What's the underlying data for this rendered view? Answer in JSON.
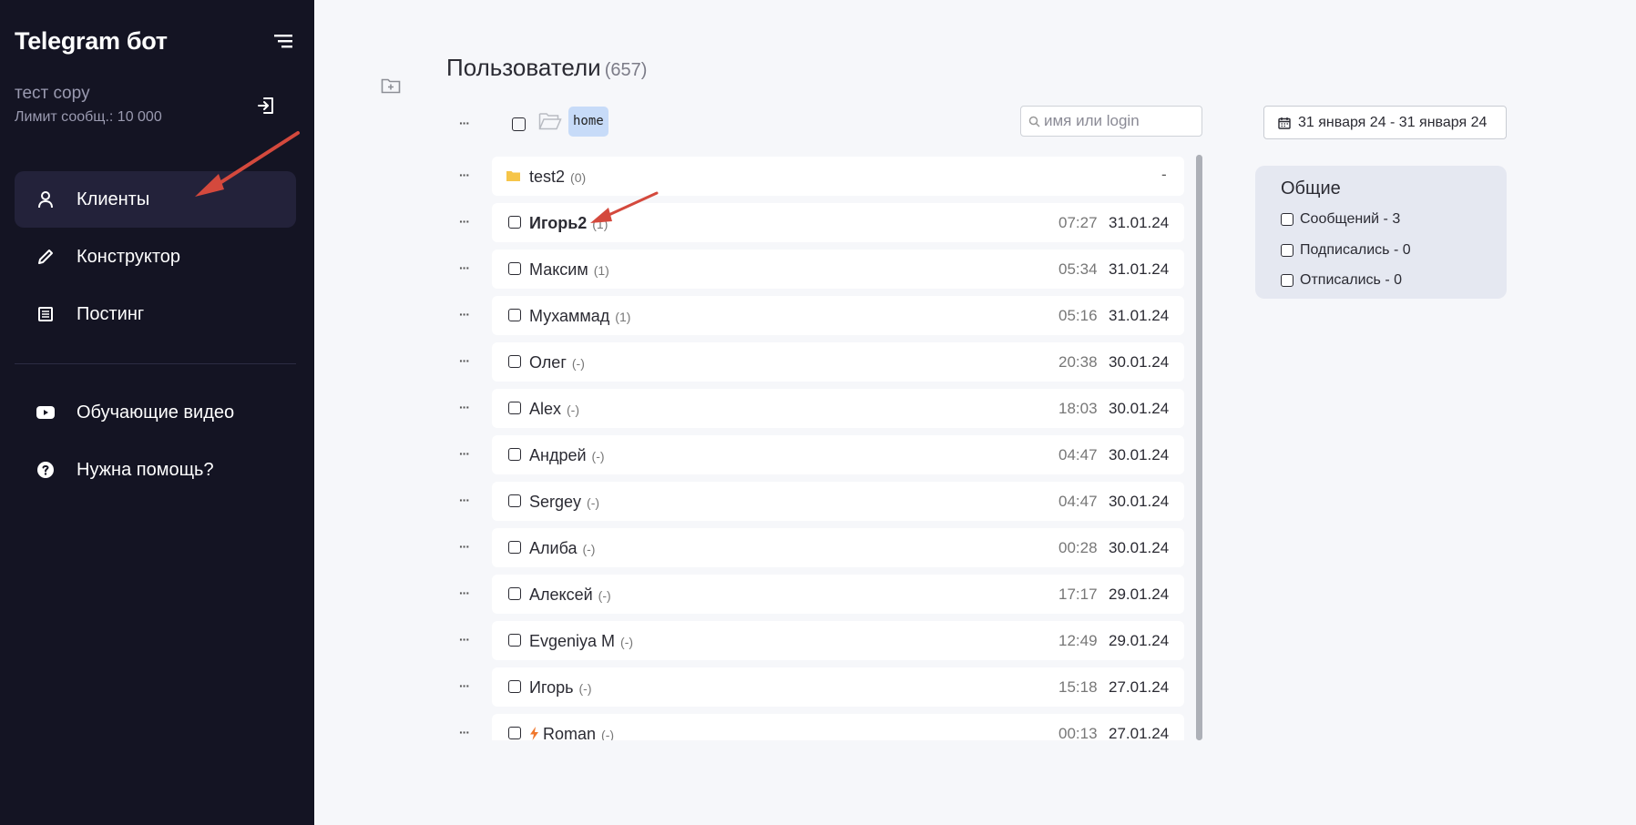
{
  "sidebar": {
    "app_title": "Telegram бот",
    "account_name": "тест copy",
    "message_limit": "Лимит сообщ.: 10 000",
    "nav": [
      {
        "label": "Клиенты",
        "icon": "user-icon",
        "active": true
      },
      {
        "label": "Конструктор",
        "icon": "pencil-icon",
        "active": false
      },
      {
        "label": "Постинг",
        "icon": "list-icon",
        "active": false
      }
    ],
    "extra": [
      {
        "label": "Обучающие видео",
        "icon": "youtube-icon"
      },
      {
        "label": "Нужна помощь?",
        "icon": "help-icon"
      }
    ]
  },
  "main": {
    "title": "Пользователи",
    "total_count": "(657)",
    "current_folder": "home",
    "search_placeholder": "имя или login",
    "date_range": "31 января 24 - 31 января 24",
    "folder_row": {
      "name": "test2",
      "count": "(0)",
      "date": "-"
    },
    "users": [
      {
        "name": "Игорь2",
        "msgs": "(1)",
        "time": "07:27",
        "date": "31.01.24",
        "bold": true
      },
      {
        "name": "Максим",
        "msgs": "(1)",
        "time": "05:34",
        "date": "31.01.24"
      },
      {
        "name": "Мухаммад",
        "msgs": "(1)",
        "time": "05:16",
        "date": "31.01.24"
      },
      {
        "name": "Олег",
        "msgs": "(-)",
        "time": "20:38",
        "date": "30.01.24"
      },
      {
        "name": "Alex",
        "msgs": "(-)",
        "time": "18:03",
        "date": "30.01.24"
      },
      {
        "name": "Андрей",
        "msgs": "(-)",
        "time": "04:47",
        "date": "30.01.24"
      },
      {
        "name": "Sergey",
        "msgs": "(-)",
        "time": "04:47",
        "date": "30.01.24"
      },
      {
        "name": "Алиба",
        "msgs": "(-)",
        "time": "00:28",
        "date": "30.01.24"
      },
      {
        "name": "Алексей",
        "msgs": "(-)",
        "time": "17:17",
        "date": "29.01.24"
      },
      {
        "name": "Evgeniya M",
        "msgs": "(-)",
        "time": "12:49",
        "date": "29.01.24"
      },
      {
        "name": "Игорь",
        "msgs": "(-)",
        "time": "15:18",
        "date": "27.01.24"
      },
      {
        "name": "Roman",
        "msgs": "(-)",
        "time": "00:13",
        "date": "27.01.24",
        "bolt": true
      }
    ]
  },
  "stats": {
    "title": "Общие",
    "items": [
      "Сообщений - 3",
      "Подписались - 0",
      "Отписались - 0"
    ]
  },
  "colors": {
    "sidebar_bg": "#141423",
    "active_nav_bg": "#23223a",
    "annotation_arrow": "#d4493d",
    "folder_chip": "#c7dbf8",
    "stats_bg": "#e5e8f1"
  }
}
